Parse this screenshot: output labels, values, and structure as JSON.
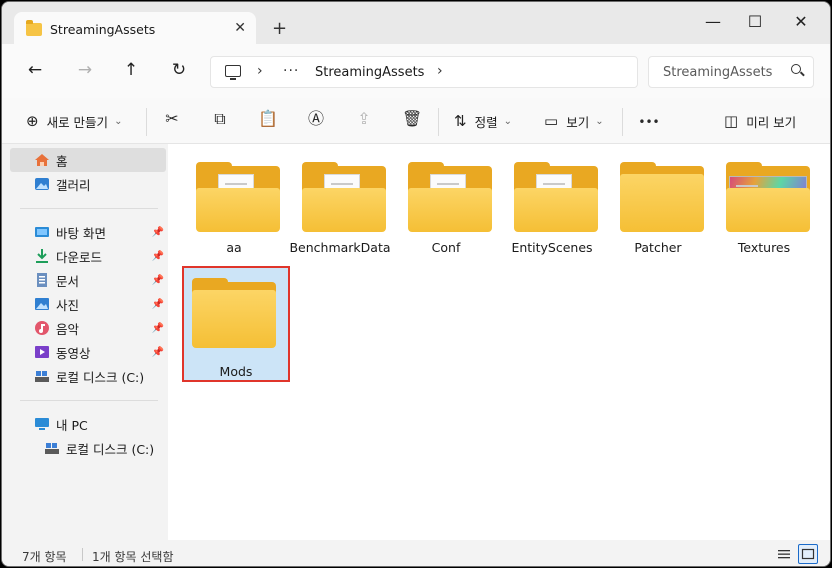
{
  "tab": {
    "title": "StreamingAssets",
    "close_glyph": "✕",
    "new_tab_glyph": "+"
  },
  "window_controls": {
    "minimize": "—",
    "maximize": "☐",
    "close": "✕"
  },
  "nav": {
    "back": "←",
    "forward": "→",
    "up": "↑",
    "refresh": "↻"
  },
  "address": {
    "chevron": "›",
    "overflow": "···",
    "crumb": "StreamingAssets",
    "chevron_end": "›"
  },
  "search": {
    "placeholder": "StreamingAssets"
  },
  "toolbar": {
    "new_label": "새로 만들기",
    "sort_label": "정렬",
    "view_label": "보기",
    "more_glyph": "•••",
    "preview_label": "미리 보기",
    "caret": "⌄"
  },
  "icons": {
    "new": "plus-circle-icon",
    "cut": "scissors-icon",
    "copy": "copy-icon",
    "paste": "paste-icon",
    "rename": "rename-icon",
    "share": "share-icon",
    "delete": "trash-icon",
    "sort": "sort-icon",
    "view": "view-icon",
    "preview": "preview-pane-icon"
  },
  "sidebar": {
    "items": [
      {
        "label": "홈",
        "icon": "home-icon",
        "selected": true
      },
      {
        "label": "갤러리",
        "icon": "gallery-icon"
      },
      {
        "label": "바탕 화면",
        "icon": "desktop-icon",
        "pinned": true
      },
      {
        "label": "다운로드",
        "icon": "download-icon",
        "pinned": true
      },
      {
        "label": "문서",
        "icon": "documents-icon",
        "pinned": true
      },
      {
        "label": "사진",
        "icon": "pictures-icon",
        "pinned": true
      },
      {
        "label": "음악",
        "icon": "music-icon",
        "pinned": true
      },
      {
        "label": "동영상",
        "icon": "videos-icon",
        "pinned": true
      },
      {
        "label": "로컬 디스크 (C:)",
        "icon": "drive-icon"
      },
      {
        "label": "내 PC",
        "icon": "this-pc-icon"
      },
      {
        "label": "로컬 디스크 (C:)",
        "icon": "drive-icon"
      }
    ],
    "pin_glyph": "📌"
  },
  "folders": [
    {
      "name": "aa",
      "preview": "doc"
    },
    {
      "name": "BenchmarkData",
      "preview": "doc"
    },
    {
      "name": "Conf",
      "preview": "doc"
    },
    {
      "name": "EntityScenes",
      "preview": "doc"
    },
    {
      "name": "Patcher",
      "preview": "empty"
    },
    {
      "name": "Textures",
      "preview": "image"
    },
    {
      "name": "Mods",
      "preview": "empty",
      "selected": true
    }
  ],
  "status": {
    "count": "7개 항목",
    "selection": "1개 항목 선택함"
  }
}
